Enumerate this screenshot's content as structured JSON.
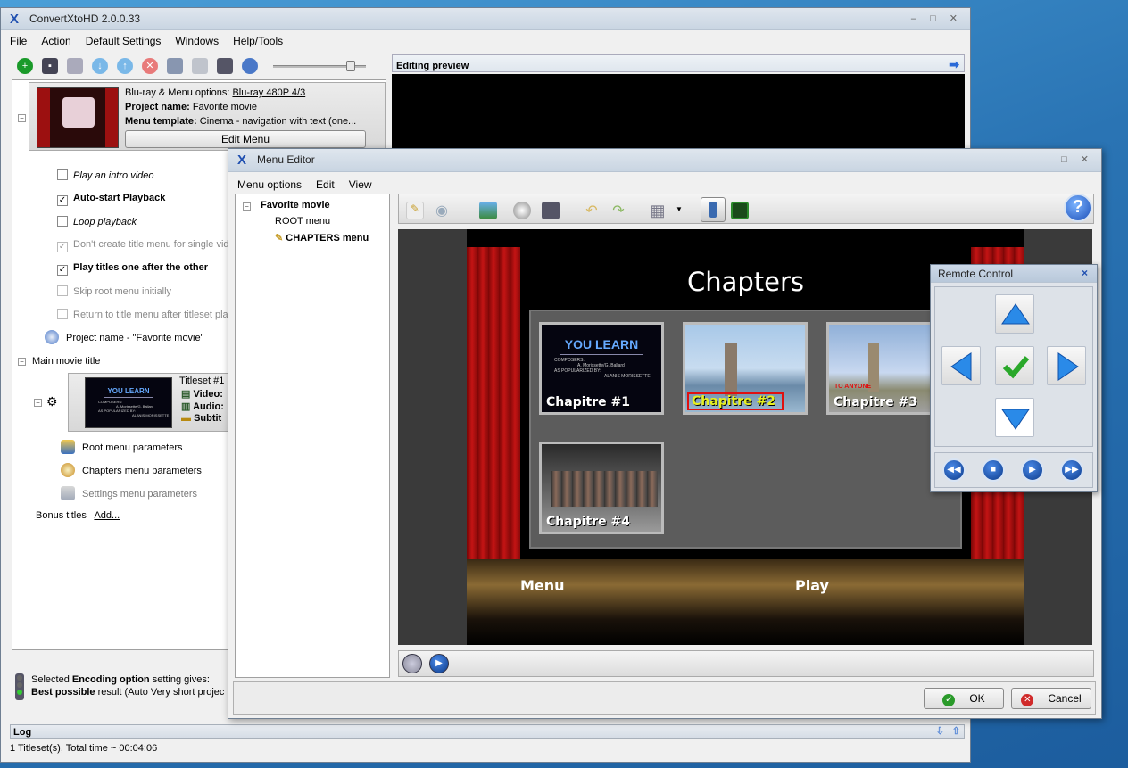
{
  "main_window": {
    "title": "ConvertXtoHD 2.0.0.33",
    "menu": [
      "File",
      "Action",
      "Default Settings",
      "Windows",
      "Help/Tools"
    ]
  },
  "project": {
    "bluray_label": "Blu-ray & Menu options:",
    "bluray_value": "Blu-ray 480P 4/3",
    "name_label": "Project name:",
    "name_value": "Favorite movie",
    "template_label": "Menu template:",
    "template_value": "Cinema - navigation with text (one...",
    "edit_menu": "Edit Menu"
  },
  "options": [
    {
      "label": "Play an intro video",
      "checked": false,
      "style": "italic"
    },
    {
      "label": "Auto-start Playback",
      "checked": true,
      "style": "bold"
    },
    {
      "label": "Loop playback",
      "checked": false,
      "style": "italic"
    },
    {
      "label": "Don't create title menu for single vid",
      "checked": true,
      "style": "disabled"
    },
    {
      "label": "Play titles one after the other",
      "checked": true,
      "style": "bold"
    },
    {
      "label": "Skip root menu initially",
      "checked": false,
      "style": "disabled"
    },
    {
      "label": "Return to title menu after titleset pla",
      "checked": false,
      "style": "disabled"
    }
  ],
  "tree": {
    "project_name_item": "Project name - \"Favorite movie\"",
    "main_movie_title": "Main movie title",
    "titleset": "Titleset #1",
    "video": "Video:",
    "audio": "Audio:",
    "subtitles": "Subtit",
    "root_menu_params": "Root menu parameters",
    "chapters_menu_params": "Chapters menu parameters",
    "settings_menu_params": "Settings menu parameters",
    "bonus_titles": "Bonus titles",
    "add": "Add..."
  },
  "status": {
    "line1_pre": "Selected ",
    "line1_bold": "Encoding option",
    "line1_post": " setting gives:",
    "line2_bold": "Best possible",
    "line2_post": " result (Auto Very short projec"
  },
  "preview": {
    "title": "Editing preview"
  },
  "log": {
    "title": "Log",
    "text": "1 Titleset(s), Total time ~ 00:04:06"
  },
  "menu_editor": {
    "title": "Menu Editor",
    "menu": [
      "Menu options",
      "Edit",
      "View"
    ],
    "tree_root": "Favorite movie",
    "tree_root_menu": "ROOT menu",
    "tree_chapters_menu": "CHAPTERS menu",
    "ok": "OK",
    "cancel": "Cancel"
  },
  "chapters_screen": {
    "title": "Chapters",
    "chapters": [
      "Chapitre #1",
      "Chapitre #2",
      "Chapitre #3",
      "Chapitre #4"
    ],
    "selected_chapter": "Chapitre #2",
    "thumb1_heading": "YOU LEARN",
    "thumb1_line1": "COMPOSERS:",
    "thumb1_line2": "A. Morissette/G. Ballard",
    "thumb1_line3": "AS POPULARIZED BY:",
    "thumb1_line4": "ALANIS MORISSETTE",
    "thumb3_text": "TO ANYONE",
    "menu_label": "Menu",
    "play_label": "Play"
  },
  "remote": {
    "title": "Remote Control",
    "close": "×"
  },
  "colors": {
    "accent": "#1f4fb0",
    "curtain": "#c41414",
    "highlight": "#e01010",
    "chapter_selected": "#e6f020"
  }
}
